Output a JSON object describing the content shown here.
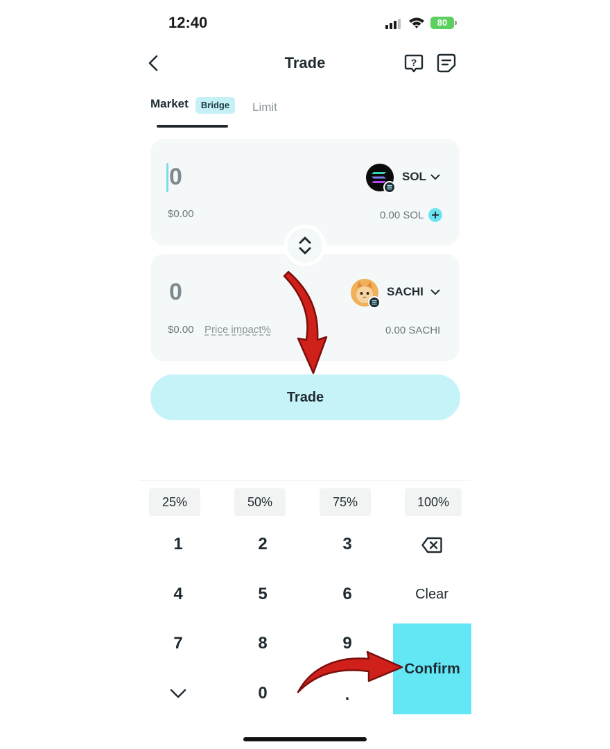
{
  "status_bar": {
    "time": "12:40",
    "battery": "80"
  },
  "header": {
    "title": "Trade",
    "help_icon": "help-icon",
    "history_icon": "orders-icon"
  },
  "tabs": {
    "market": "Market",
    "market_badge": "Bridge",
    "limit": "Limit"
  },
  "from": {
    "amount": "0",
    "usd": "$0.00",
    "token": "SOL",
    "balance": "0.00 SOL"
  },
  "to": {
    "amount": "0",
    "usd": "$0.00",
    "price_impact": "Price impact%",
    "token": "SACHI",
    "balance": "0.00 SACHI"
  },
  "trade_button": "Trade",
  "percent_buttons": [
    "25%",
    "50%",
    "75%",
    "100%"
  ],
  "keypad": {
    "k1": "1",
    "k2": "2",
    "k3": "3",
    "k4": "4",
    "k5": "5",
    "k6": "6",
    "k7": "7",
    "k8": "8",
    "k9": "9",
    "k0": "0",
    "dot": ".",
    "clear": "Clear",
    "confirm": "Confirm"
  },
  "colors": {
    "accent": "#63e7f5",
    "accent_light": "#c6f3f8",
    "card_bg": "#f5f8f8",
    "annotation_arrow": "#d0201a"
  }
}
